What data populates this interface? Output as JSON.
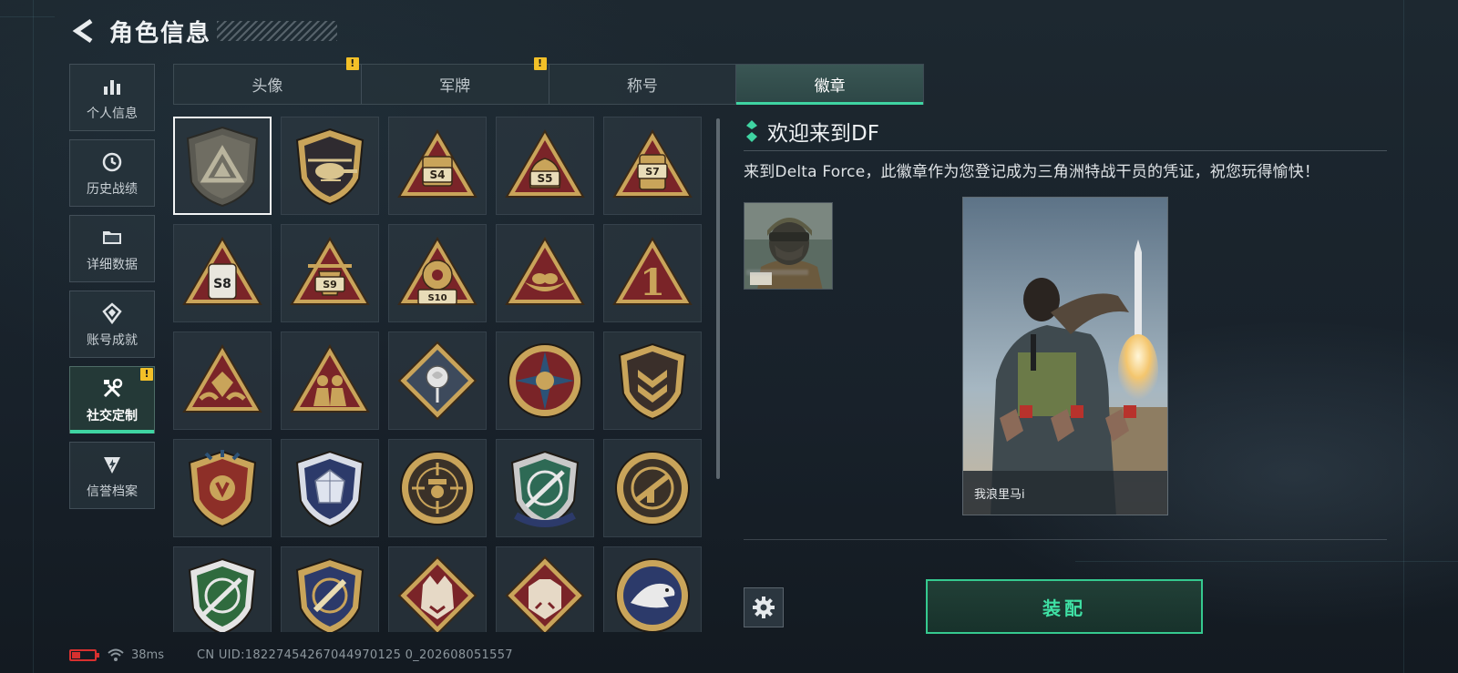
{
  "header": {
    "title": "角色信息"
  },
  "sidebar": {
    "items": [
      {
        "label": "个人信息",
        "icon": "bar-chart-icon",
        "active": false,
        "warning": false
      },
      {
        "label": "历史战绩",
        "icon": "clock-icon",
        "active": false,
        "warning": false
      },
      {
        "label": "详细数据",
        "icon": "folder-icon",
        "active": false,
        "warning": false
      },
      {
        "label": "账号成就",
        "icon": "medal-icon",
        "active": false,
        "warning": false
      },
      {
        "label": "社交定制",
        "icon": "tools-icon",
        "active": true,
        "warning": true
      },
      {
        "label": "信誉档案",
        "icon": "shield-bolt-icon",
        "active": false,
        "warning": false
      }
    ]
  },
  "tabs": [
    {
      "label": "头像",
      "active": false,
      "warning": true
    },
    {
      "label": "军牌",
      "active": false,
      "warning": true
    },
    {
      "label": "称号",
      "active": false,
      "warning": false
    },
    {
      "label": "徽章",
      "active": true,
      "warning": false
    }
  ],
  "badges": [
    {
      "icon": "delta-shield-badge",
      "text": "",
      "selected": true
    },
    {
      "icon": "helicopter-badge",
      "text": "",
      "selected": false
    },
    {
      "icon": "season-s4-badge",
      "text": "S4",
      "selected": false
    },
    {
      "icon": "season-s5-badge",
      "text": "S5",
      "selected": false
    },
    {
      "icon": "season-s7-badge",
      "text": "S7",
      "selected": false
    },
    {
      "icon": "season-s8-badge",
      "text": "S8",
      "selected": false
    },
    {
      "icon": "season-s9-badge",
      "text": "S9",
      "selected": false
    },
    {
      "icon": "season-s10-badge",
      "text": "S10",
      "selected": false
    },
    {
      "icon": "nest-egg-badge",
      "text": "",
      "selected": false
    },
    {
      "icon": "number-one-badge",
      "text": "1",
      "selected": false
    },
    {
      "icon": "hands-gem-badge",
      "text": "",
      "selected": false
    },
    {
      "icon": "soldiers-badge",
      "text": "",
      "selected": false
    },
    {
      "icon": "rose-diamond-badge",
      "text": "",
      "selected": false
    },
    {
      "icon": "star-wheel-badge",
      "text": "",
      "selected": false
    },
    {
      "icon": "chevron-shield-badge",
      "text": "",
      "selected": false
    },
    {
      "icon": "laurel-shield-badge",
      "text": "",
      "selected": false
    },
    {
      "icon": "crystal-shield-badge",
      "text": "",
      "selected": false
    },
    {
      "icon": "crosshair-agent-badge",
      "text": "",
      "selected": false
    },
    {
      "icon": "sniper-shield-badge",
      "text": "",
      "selected": false
    },
    {
      "icon": "gun-shield-badge",
      "text": "",
      "selected": false
    },
    {
      "icon": "green-rifle-shield-badge",
      "text": "",
      "selected": false
    },
    {
      "icon": "gold-blade-shield-badge",
      "text": "",
      "selected": false
    },
    {
      "icon": "wolf-diamond-badge",
      "text": "",
      "selected": false
    },
    {
      "icon": "boar-diamond-badge",
      "text": "",
      "selected": false
    },
    {
      "icon": "eagle-circle-badge",
      "text": "",
      "selected": false
    }
  ],
  "detail": {
    "title": "欢迎来到DF",
    "description": "来到Delta Force，此徽章作为您登记成为三角洲特战干员的凭证，祝您玩得愉快！",
    "card_name": "我浪里马i",
    "equip_label": "装配",
    "settings_icon": "gear-icon",
    "accent": "#3fd4a2"
  },
  "status": {
    "ping": "38ms",
    "uid": "CN UID:18227454267044970125 0_202608051557"
  },
  "colors": {
    "warning": "#f2c028",
    "accent": "#3fd4a2",
    "battery": "#d8302f"
  }
}
